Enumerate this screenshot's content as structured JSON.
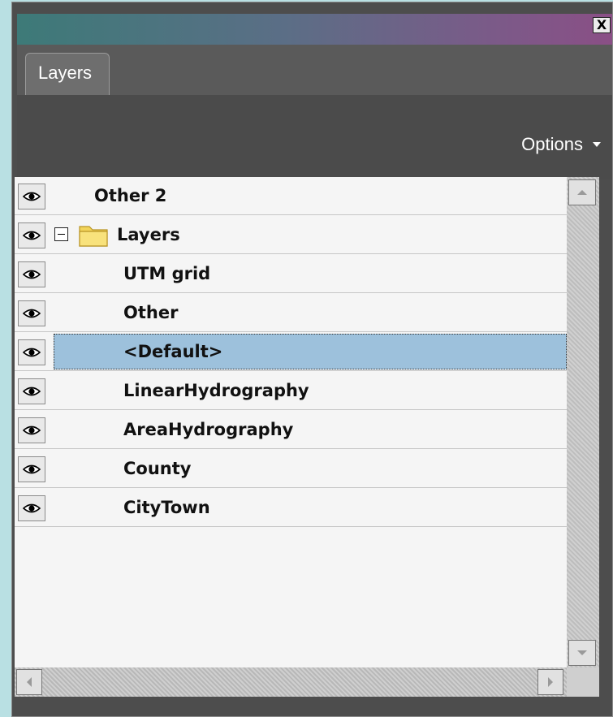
{
  "window": {
    "close_label": "X"
  },
  "tabs": [
    {
      "label": "Layers",
      "active": true
    }
  ],
  "toolbar": {
    "options_label": "Options"
  },
  "layers": [
    {
      "label": "Other 2",
      "visible": true,
      "selected": false
    },
    {
      "label": "Layers",
      "visible": true,
      "selected": false,
      "is_group": true,
      "expanded": true
    },
    {
      "label": "UTM grid",
      "visible": true,
      "selected": false
    },
    {
      "label": "Other",
      "visible": true,
      "selected": false
    },
    {
      "label": "<Default>",
      "visible": true,
      "selected": true
    },
    {
      "label": "LinearHydrography",
      "visible": true,
      "selected": false
    },
    {
      "label": "AreaHydrography",
      "visible": true,
      "selected": false
    },
    {
      "label": "County",
      "visible": true,
      "selected": false
    },
    {
      "label": "CityTown",
      "visible": true,
      "selected": false
    }
  ],
  "icons": {
    "visibility": "eye-icon",
    "group": "folder-icon",
    "collapse": "minus-box-icon"
  },
  "colors": {
    "selection": "#9dc1dc",
    "panel_bg": "#4d4d4d",
    "list_bg": "#f5f5f5"
  }
}
